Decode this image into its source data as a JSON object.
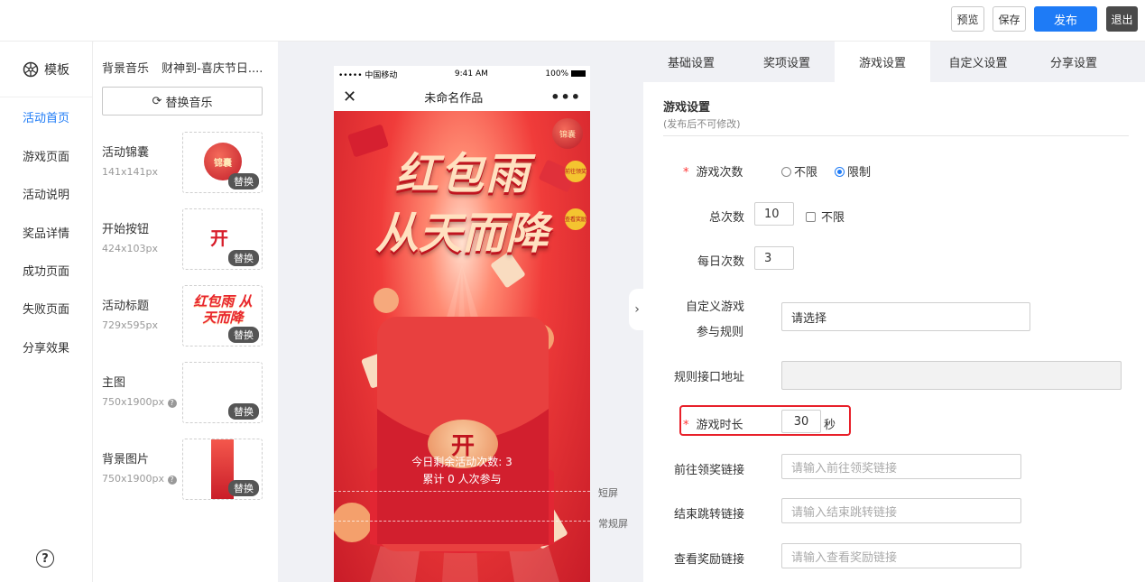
{
  "toolbar": {
    "preview": "预览",
    "save": "保存",
    "publish": "发布",
    "exit": "退出",
    "colors": {
      "primary": "#1e7bf6",
      "dark": "#4a4a4a"
    }
  },
  "leftnav": {
    "logo_label": "模板",
    "items": [
      "活动首页",
      "游戏页面",
      "活动说明",
      "奖品详情",
      "成功页面",
      "失败页面",
      "分享效果"
    ],
    "active_index": 0,
    "help_symbol": "?"
  },
  "resources": {
    "music_label": "背景音乐",
    "music_name": "财神到-喜庆节日....",
    "replace_music": "替换音乐",
    "swap_label": "替换",
    "items": [
      {
        "name": "活动锦囊",
        "size": "141x141px",
        "thumb_text": "锦囊"
      },
      {
        "name": "开始按钮",
        "size": "424x103px",
        "thumb_text": "开"
      },
      {
        "name": "活动标题",
        "size": "729x595px",
        "thumb_text": "红包雨 从天而降"
      },
      {
        "name": "主图",
        "size": "750x1900px",
        "thumb_text": ""
      },
      {
        "name": "背景图片",
        "size": "750x1900px",
        "thumb_text": ""
      }
    ]
  },
  "phone": {
    "carrier": "•••••  中国移动",
    "time": "9:41 AM",
    "battery": "100%",
    "title": "未命名作品",
    "headline1": "红包雨",
    "headline2": "从天而降",
    "side_badge1": "前往领奖",
    "side_badge2": "查看奖励",
    "corner_badge": "锦囊",
    "start_char": "开",
    "remaining": "今日剩余活动次数: 3",
    "participants": "累计 0 人次参与",
    "marker_short": "短屏",
    "marker_normal": "常规屏"
  },
  "settings": {
    "tabs": [
      "基础设置",
      "奖项设置",
      "游戏设置",
      "自定义设置",
      "分享设置"
    ],
    "active_tab": 2,
    "section_title": "游戏设置",
    "section_note": "(发布后不可修改)",
    "game_count_label": "游戏次数",
    "opt_unlimited": "不限",
    "opt_limited": "限制",
    "total_label": "总次数",
    "total_value": "10",
    "total_unlimited": "不限",
    "daily_label": "每日次数",
    "daily_value": "3",
    "rule_label_1": "自定义游戏",
    "rule_label_2": "参与规则",
    "rule_select": "请选择",
    "api_label": "规则接口地址",
    "api_value": "",
    "duration_label": "游戏时长",
    "duration_value": "30",
    "duration_unit": "秒",
    "prize_link_label": "前往领奖链接",
    "prize_link_placeholder": "请输入前往领奖链接",
    "end_link_label": "结束跳转链接",
    "end_link_placeholder": "请输入结束跳转链接",
    "reward_link_label": "查看奖励链接",
    "reward_link_placeholder": "请输入查看奖励链接",
    "highlight_color": "#e8202a"
  }
}
